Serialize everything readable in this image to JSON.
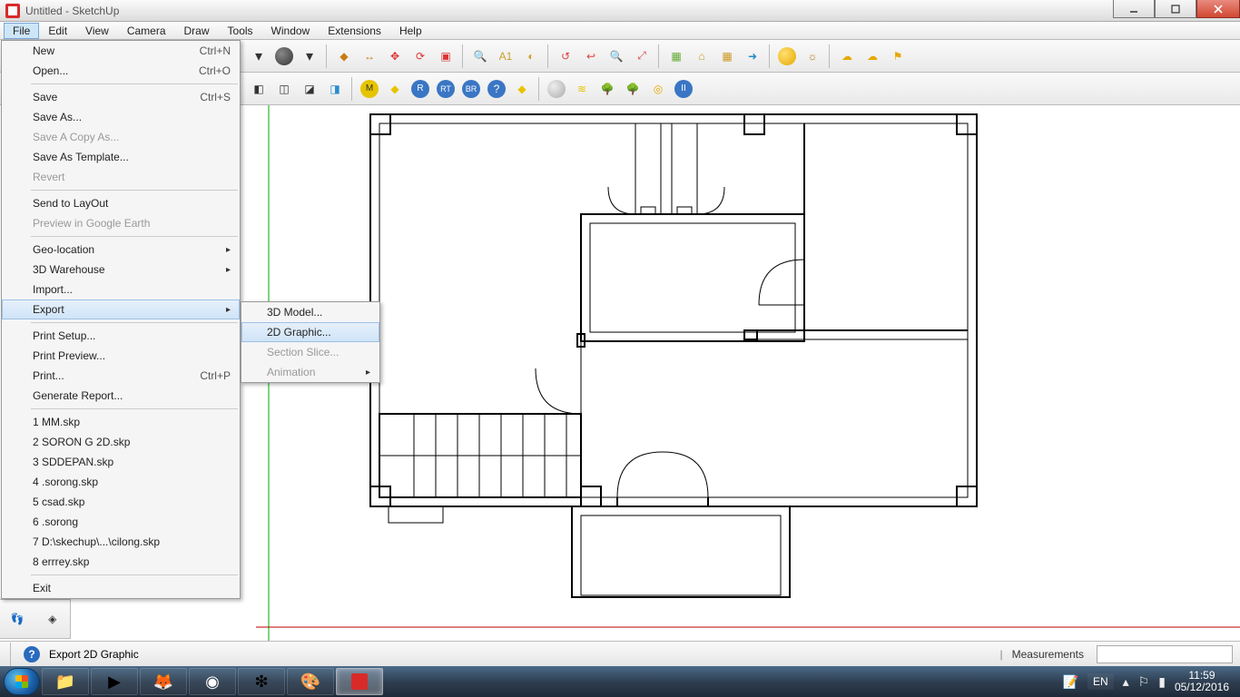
{
  "window": {
    "title": "Untitled - SketchUp"
  },
  "menu": {
    "items": [
      "File",
      "Edit",
      "View",
      "Camera",
      "Draw",
      "Tools",
      "Window",
      "Extensions",
      "Help"
    ]
  },
  "file_menu": {
    "groups": [
      [
        {
          "label": "New",
          "shortcut": "Ctrl+N"
        },
        {
          "label": "Open...",
          "shortcut": "Ctrl+O"
        }
      ],
      [
        {
          "label": "Save",
          "shortcut": "Ctrl+S"
        },
        {
          "label": "Save As..."
        },
        {
          "label": "Save A Copy As...",
          "disabled": true
        },
        {
          "label": "Save As Template..."
        },
        {
          "label": "Revert",
          "disabled": true
        }
      ],
      [
        {
          "label": "Send to LayOut"
        },
        {
          "label": "Preview in Google Earth",
          "disabled": true
        }
      ],
      [
        {
          "label": "Geo-location",
          "submenu": true
        },
        {
          "label": "3D Warehouse",
          "submenu": true
        },
        {
          "label": "Import..."
        },
        {
          "label": "Export",
          "submenu": true,
          "hover": true
        }
      ],
      [
        {
          "label": "Print Setup..."
        },
        {
          "label": "Print Preview..."
        },
        {
          "label": "Print...",
          "shortcut": "Ctrl+P"
        },
        {
          "label": "Generate Report..."
        }
      ],
      [
        {
          "label": "1 MM.skp"
        },
        {
          "label": "2 SORON G 2D.skp"
        },
        {
          "label": "3 SDDEPAN.skp"
        },
        {
          "label": "4 .sorong.skp"
        },
        {
          "label": "5 csad.skp"
        },
        {
          "label": "6 .sorong"
        },
        {
          "label": "7 D:\\skechup\\...\\cilong.skp"
        },
        {
          "label": "8 errrey.skp"
        }
      ],
      [
        {
          "label": "Exit"
        }
      ]
    ]
  },
  "export_menu": {
    "items": [
      {
        "label": "3D Model..."
      },
      {
        "label": "2D Graphic...",
        "hover": true
      },
      {
        "label": "Section Slice...",
        "disabled": true
      },
      {
        "label": "Animation",
        "submenu": true,
        "disabled": true
      }
    ]
  },
  "status": {
    "hint": "Export 2D Graphic",
    "meas_label": "Measurements"
  },
  "tray": {
    "lang": "EN",
    "time": "11:59",
    "date": "05/12/2016"
  }
}
